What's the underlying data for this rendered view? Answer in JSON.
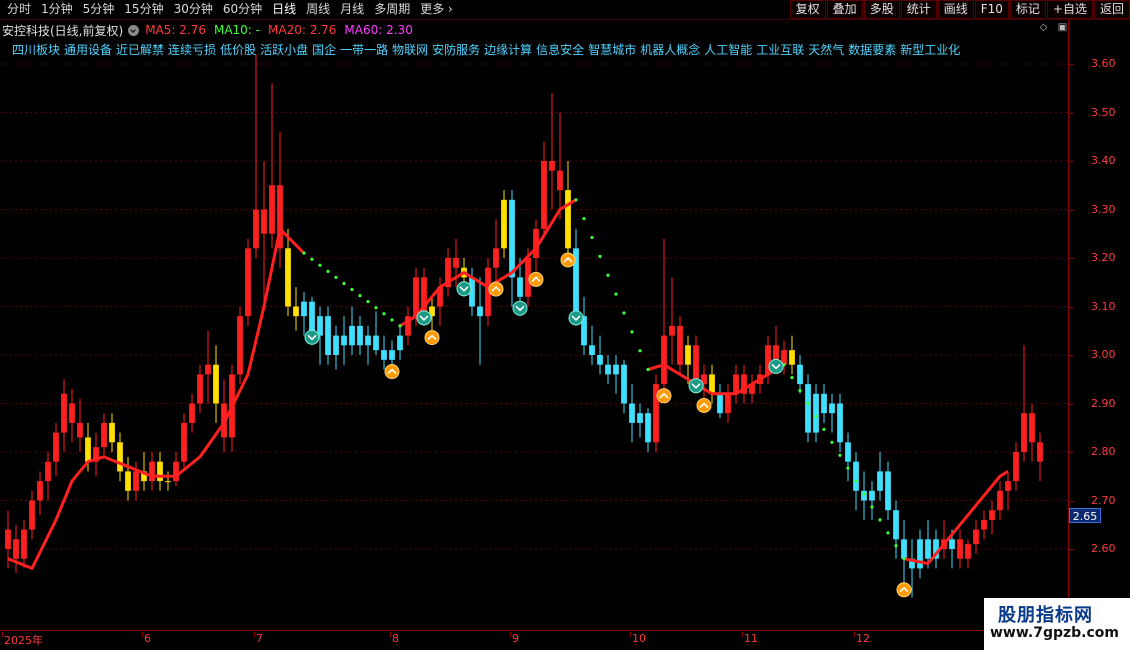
{
  "toolbar": {
    "periods": [
      "分时",
      "1分钟",
      "5分钟",
      "15分钟",
      "30分钟",
      "60分钟",
      "日线",
      "周线",
      "月线",
      "多周期",
      "更多"
    ],
    "active_period": "日线",
    "right_buttons": [
      "复权",
      "叠加",
      "多股",
      "统计",
      "画线",
      "F10",
      "标记",
      "+自选",
      "返回"
    ]
  },
  "title": {
    "stock": "安控科技(日线,前复权)",
    "ma": [
      {
        "label": "MA5: 2.76",
        "color": "#ff3b3b"
      },
      {
        "label": "MA10: -",
        "color": "#3bff3b"
      },
      {
        "label": "MA20: 2.76",
        "color": "#ff3b3b"
      },
      {
        "label": "MA60: 2.30",
        "color": "#ff3bff"
      }
    ]
  },
  "concepts": [
    "四川板块",
    "通用设备",
    "近已解禁",
    "连续亏损",
    "低价股",
    "活跃小盘",
    "国企",
    "一带一路",
    "物联网",
    "安防服务",
    "边缘计算",
    "信息安全",
    "智慧城市",
    "机器人概念",
    "人工智能",
    "工业互联",
    "天然气",
    "数据要素",
    "新型工业化"
  ],
  "price_axis": {
    "ticks": [
      "3.60",
      "3.50",
      "3.40",
      "3.30",
      "3.20",
      "3.10",
      "3.00",
      "2.90",
      "2.80",
      "2.70",
      "2.60"
    ],
    "current": "2.65"
  },
  "date_axis": {
    "ticks": [
      "2025年",
      "6",
      "7",
      "8",
      "9",
      "10",
      "11",
      "12"
    ]
  },
  "watermark": {
    "title": "股朋指标网",
    "url": "www.7gpzb.com"
  },
  "colors": {
    "up": "#ff2020",
    "down": "#3fe0ff",
    "signal_up": "#ffe000",
    "ma": "#ff2020",
    "dots": "#3bff3b",
    "grid": "#5a0000"
  },
  "chart_data": {
    "type": "candlestick",
    "y_range": [
      2.5,
      3.65
    ],
    "candles": [
      {
        "o": 2.6,
        "h": 2.68,
        "l": 2.56,
        "c": 2.64,
        "s": "up"
      },
      {
        "o": 2.62,
        "h": 2.65,
        "l": 2.55,
        "c": 2.58,
        "s": "up"
      },
      {
        "o": 2.58,
        "h": 2.66,
        "l": 2.56,
        "c": 2.64,
        "s": "up"
      },
      {
        "o": 2.64,
        "h": 2.72,
        "l": 2.62,
        "c": 2.7,
        "s": "up"
      },
      {
        "o": 2.7,
        "h": 2.76,
        "l": 2.67,
        "c": 2.74,
        "s": "up"
      },
      {
        "o": 2.74,
        "h": 2.8,
        "l": 2.7,
        "c": 2.78,
        "s": "up"
      },
      {
        "o": 2.78,
        "h": 2.86,
        "l": 2.75,
        "c": 2.84,
        "s": "up"
      },
      {
        "o": 2.84,
        "h": 2.95,
        "l": 2.8,
        "c": 2.92,
        "s": "up"
      },
      {
        "o": 2.9,
        "h": 2.93,
        "l": 2.82,
        "c": 2.86,
        "s": "up"
      },
      {
        "o": 2.86,
        "h": 2.91,
        "l": 2.8,
        "c": 2.83,
        "s": "up"
      },
      {
        "o": 2.83,
        "h": 2.86,
        "l": 2.76,
        "c": 2.78,
        "s": "y"
      },
      {
        "o": 2.78,
        "h": 2.84,
        "l": 2.75,
        "c": 2.81,
        "s": "up"
      },
      {
        "o": 2.81,
        "h": 2.88,
        "l": 2.79,
        "c": 2.86,
        "s": "up"
      },
      {
        "o": 2.86,
        "h": 2.88,
        "l": 2.8,
        "c": 2.82,
        "s": "y"
      },
      {
        "o": 2.82,
        "h": 2.84,
        "l": 2.74,
        "c": 2.76,
        "s": "y"
      },
      {
        "o": 2.76,
        "h": 2.79,
        "l": 2.7,
        "c": 2.72,
        "s": "y"
      },
      {
        "o": 2.72,
        "h": 2.78,
        "l": 2.7,
        "c": 2.76,
        "s": "up"
      },
      {
        "o": 2.76,
        "h": 2.8,
        "l": 2.72,
        "c": 2.74,
        "s": "y"
      },
      {
        "o": 2.74,
        "h": 2.8,
        "l": 2.72,
        "c": 2.78,
        "s": "up"
      },
      {
        "o": 2.78,
        "h": 2.8,
        "l": 2.72,
        "c": 2.74,
        "s": "y"
      },
      {
        "o": 2.74,
        "h": 2.76,
        "l": 2.72,
        "c": 2.74,
        "s": "y"
      },
      {
        "o": 2.74,
        "h": 2.8,
        "l": 2.73,
        "c": 2.78,
        "s": "up"
      },
      {
        "o": 2.78,
        "h": 2.88,
        "l": 2.76,
        "c": 2.86,
        "s": "up"
      },
      {
        "o": 2.86,
        "h": 2.92,
        "l": 2.84,
        "c": 2.9,
        "s": "up"
      },
      {
        "o": 2.9,
        "h": 2.98,
        "l": 2.88,
        "c": 2.96,
        "s": "up"
      },
      {
        "o": 2.96,
        "h": 3.05,
        "l": 2.9,
        "c": 2.98,
        "s": "up"
      },
      {
        "o": 2.98,
        "h": 3.02,
        "l": 2.86,
        "c": 2.9,
        "s": "y"
      },
      {
        "o": 2.9,
        "h": 2.95,
        "l": 2.8,
        "c": 2.83,
        "s": "up"
      },
      {
        "o": 2.83,
        "h": 2.98,
        "l": 2.8,
        "c": 2.96,
        "s": "up"
      },
      {
        "o": 2.96,
        "h": 3.1,
        "l": 2.94,
        "c": 3.08,
        "s": "up"
      },
      {
        "o": 3.08,
        "h": 3.24,
        "l": 3.06,
        "c": 3.22,
        "s": "up"
      },
      {
        "o": 3.22,
        "h": 3.62,
        "l": 3.2,
        "c": 3.3,
        "s": "up"
      },
      {
        "o": 3.3,
        "h": 3.4,
        "l": 3.1,
        "c": 3.25,
        "s": "up"
      },
      {
        "o": 3.25,
        "h": 3.56,
        "l": 3.22,
        "c": 3.35,
        "s": "up"
      },
      {
        "o": 3.35,
        "h": 3.46,
        "l": 3.18,
        "c": 3.22,
        "s": "up"
      },
      {
        "o": 3.22,
        "h": 3.26,
        "l": 3.08,
        "c": 3.1,
        "s": "y"
      },
      {
        "o": 3.1,
        "h": 3.14,
        "l": 3.05,
        "c": 3.08,
        "s": "y"
      },
      {
        "o": 3.08,
        "h": 3.13,
        "l": 3.04,
        "c": 3.11,
        "s": "dn"
      },
      {
        "o": 3.11,
        "h": 3.12,
        "l": 3.02,
        "c": 3.04,
        "s": "dn"
      },
      {
        "o": 3.04,
        "h": 3.1,
        "l": 2.98,
        "c": 3.08,
        "s": "dn"
      },
      {
        "o": 3.08,
        "h": 3.1,
        "l": 2.98,
        "c": 3.0,
        "s": "dn"
      },
      {
        "o": 3.0,
        "h": 3.06,
        "l": 2.97,
        "c": 3.04,
        "s": "dn"
      },
      {
        "o": 3.04,
        "h": 3.08,
        "l": 2.98,
        "c": 3.02,
        "s": "dn"
      },
      {
        "o": 3.02,
        "h": 3.1,
        "l": 3.0,
        "c": 3.06,
        "s": "dn"
      },
      {
        "o": 3.06,
        "h": 3.08,
        "l": 3.0,
        "c": 3.02,
        "s": "dn"
      },
      {
        "o": 3.02,
        "h": 3.06,
        "l": 2.98,
        "c": 3.04,
        "s": "dn"
      },
      {
        "o": 3.04,
        "h": 3.09,
        "l": 3.0,
        "c": 3.01,
        "s": "dn"
      },
      {
        "o": 3.01,
        "h": 3.04,
        "l": 2.97,
        "c": 2.99,
        "s": "dn"
      },
      {
        "o": 2.99,
        "h": 3.03,
        "l": 2.97,
        "c": 3.01,
        "s": "dn"
      },
      {
        "o": 3.01,
        "h": 3.06,
        "l": 2.99,
        "c": 3.04,
        "s": "dn"
      },
      {
        "o": 3.04,
        "h": 3.1,
        "l": 3.02,
        "c": 3.08,
        "s": "up"
      },
      {
        "o": 3.08,
        "h": 3.18,
        "l": 3.06,
        "c": 3.16,
        "s": "up"
      },
      {
        "o": 3.16,
        "h": 3.18,
        "l": 3.06,
        "c": 3.08,
        "s": "up"
      },
      {
        "o": 3.08,
        "h": 3.12,
        "l": 3.04,
        "c": 3.1,
        "s": "y"
      },
      {
        "o": 3.1,
        "h": 3.16,
        "l": 3.06,
        "c": 3.14,
        "s": "up"
      },
      {
        "o": 3.14,
        "h": 3.22,
        "l": 3.12,
        "c": 3.2,
        "s": "up"
      },
      {
        "o": 3.2,
        "h": 3.24,
        "l": 3.14,
        "c": 3.18,
        "s": "up"
      },
      {
        "o": 3.18,
        "h": 3.2,
        "l": 3.12,
        "c": 3.16,
        "s": "y"
      },
      {
        "o": 3.16,
        "h": 3.18,
        "l": 3.08,
        "c": 3.1,
        "s": "dn"
      },
      {
        "o": 3.1,
        "h": 3.16,
        "l": 2.98,
        "c": 3.08,
        "s": "dn"
      },
      {
        "o": 3.08,
        "h": 3.2,
        "l": 3.06,
        "c": 3.18,
        "s": "up"
      },
      {
        "o": 3.18,
        "h": 3.28,
        "l": 3.14,
        "c": 3.22,
        "s": "up"
      },
      {
        "o": 3.22,
        "h": 3.34,
        "l": 3.2,
        "c": 3.32,
        "s": "y"
      },
      {
        "o": 3.32,
        "h": 3.34,
        "l": 3.1,
        "c": 3.16,
        "s": "dn"
      },
      {
        "o": 3.16,
        "h": 3.2,
        "l": 3.08,
        "c": 3.12,
        "s": "dn"
      },
      {
        "o": 3.12,
        "h": 3.22,
        "l": 3.1,
        "c": 3.2,
        "s": "up"
      },
      {
        "o": 3.2,
        "h": 3.28,
        "l": 3.16,
        "c": 3.26,
        "s": "up"
      },
      {
        "o": 3.26,
        "h": 3.44,
        "l": 3.24,
        "c": 3.4,
        "s": "up"
      },
      {
        "o": 3.4,
        "h": 3.54,
        "l": 3.3,
        "c": 3.38,
        "s": "up"
      },
      {
        "o": 3.38,
        "h": 3.5,
        "l": 3.28,
        "c": 3.34,
        "s": "up"
      },
      {
        "o": 3.34,
        "h": 3.4,
        "l": 3.2,
        "c": 3.22,
        "s": "y"
      },
      {
        "o": 3.22,
        "h": 3.26,
        "l": 3.06,
        "c": 3.08,
        "s": "dn"
      },
      {
        "o": 3.08,
        "h": 3.12,
        "l": 3.0,
        "c": 3.02,
        "s": "dn"
      },
      {
        "o": 3.02,
        "h": 3.06,
        "l": 2.98,
        "c": 3.0,
        "s": "dn"
      },
      {
        "o": 3.0,
        "h": 3.04,
        "l": 2.96,
        "c": 2.98,
        "s": "dn"
      },
      {
        "o": 2.98,
        "h": 3.0,
        "l": 2.94,
        "c": 2.96,
        "s": "dn"
      },
      {
        "o": 2.96,
        "h": 3.0,
        "l": 2.92,
        "c": 2.98,
        "s": "dn"
      },
      {
        "o": 2.98,
        "h": 2.99,
        "l": 2.88,
        "c": 2.9,
        "s": "dn"
      },
      {
        "o": 2.9,
        "h": 2.94,
        "l": 2.82,
        "c": 2.86,
        "s": "dn"
      },
      {
        "o": 2.86,
        "h": 2.9,
        "l": 2.83,
        "c": 2.88,
        "s": "dn"
      },
      {
        "o": 2.88,
        "h": 2.89,
        "l": 2.8,
        "c": 2.82,
        "s": "dn"
      },
      {
        "o": 2.82,
        "h": 2.96,
        "l": 2.8,
        "c": 2.94,
        "s": "up"
      },
      {
        "o": 2.94,
        "h": 3.24,
        "l": 2.92,
        "c": 3.04,
        "s": "up"
      },
      {
        "o": 3.04,
        "h": 3.16,
        "l": 2.98,
        "c": 3.06,
        "s": "up"
      },
      {
        "o": 3.06,
        "h": 3.08,
        "l": 2.96,
        "c": 2.98,
        "s": "up"
      },
      {
        "o": 2.98,
        "h": 3.04,
        "l": 2.94,
        "c": 3.02,
        "s": "y"
      },
      {
        "o": 3.02,
        "h": 3.04,
        "l": 2.92,
        "c": 2.94,
        "s": "up"
      },
      {
        "o": 2.94,
        "h": 2.98,
        "l": 2.9,
        "c": 2.96,
        "s": "up"
      },
      {
        "o": 2.96,
        "h": 2.98,
        "l": 2.9,
        "c": 2.92,
        "s": "y"
      },
      {
        "o": 2.92,
        "h": 2.94,
        "l": 2.87,
        "c": 2.88,
        "s": "dn"
      },
      {
        "o": 2.88,
        "h": 2.94,
        "l": 2.86,
        "c": 2.92,
        "s": "up"
      },
      {
        "o": 2.92,
        "h": 2.98,
        "l": 2.9,
        "c": 2.96,
        "s": "up"
      },
      {
        "o": 2.96,
        "h": 2.98,
        "l": 2.9,
        "c": 2.92,
        "s": "up"
      },
      {
        "o": 2.92,
        "h": 2.96,
        "l": 2.9,
        "c": 2.94,
        "s": "up"
      },
      {
        "o": 2.94,
        "h": 2.98,
        "l": 2.92,
        "c": 2.96,
        "s": "up"
      },
      {
        "o": 2.96,
        "h": 3.04,
        "l": 2.94,
        "c": 3.02,
        "s": "up"
      },
      {
        "o": 3.02,
        "h": 3.06,
        "l": 2.96,
        "c": 2.98,
        "s": "up"
      },
      {
        "o": 2.98,
        "h": 3.03,
        "l": 2.96,
        "c": 3.01,
        "s": "up"
      },
      {
        "o": 3.01,
        "h": 3.04,
        "l": 2.96,
        "c": 2.98,
        "s": "y"
      },
      {
        "o": 2.98,
        "h": 3.0,
        "l": 2.92,
        "c": 2.94,
        "s": "dn"
      },
      {
        "o": 2.94,
        "h": 2.96,
        "l": 2.82,
        "c": 2.84,
        "s": "dn"
      },
      {
        "o": 2.84,
        "h": 2.94,
        "l": 2.82,
        "c": 2.92,
        "s": "dn"
      },
      {
        "o": 2.92,
        "h": 2.94,
        "l": 2.86,
        "c": 2.88,
        "s": "dn"
      },
      {
        "o": 2.88,
        "h": 2.92,
        "l": 2.84,
        "c": 2.9,
        "s": "dn"
      },
      {
        "o": 2.9,
        "h": 2.92,
        "l": 2.8,
        "c": 2.82,
        "s": "dn"
      },
      {
        "o": 2.82,
        "h": 2.84,
        "l": 2.74,
        "c": 2.78,
        "s": "dn"
      },
      {
        "o": 2.78,
        "h": 2.8,
        "l": 2.68,
        "c": 2.72,
        "s": "dn"
      },
      {
        "o": 2.72,
        "h": 2.76,
        "l": 2.66,
        "c": 2.7,
        "s": "dn"
      },
      {
        "o": 2.7,
        "h": 2.74,
        "l": 2.66,
        "c": 2.72,
        "s": "dn"
      },
      {
        "o": 2.72,
        "h": 2.8,
        "l": 2.7,
        "c": 2.76,
        "s": "dn"
      },
      {
        "o": 2.76,
        "h": 2.78,
        "l": 2.66,
        "c": 2.68,
        "s": "dn"
      },
      {
        "o": 2.68,
        "h": 2.7,
        "l": 2.58,
        "c": 2.62,
        "s": "dn"
      },
      {
        "o": 2.62,
        "h": 2.66,
        "l": 2.52,
        "c": 2.58,
        "s": "dn"
      },
      {
        "o": 2.58,
        "h": 2.62,
        "l": 2.5,
        "c": 2.56,
        "s": "dn"
      },
      {
        "o": 2.56,
        "h": 2.64,
        "l": 2.54,
        "c": 2.62,
        "s": "dn"
      },
      {
        "o": 2.62,
        "h": 2.66,
        "l": 2.56,
        "c": 2.58,
        "s": "dn"
      },
      {
        "o": 2.58,
        "h": 2.64,
        "l": 2.56,
        "c": 2.62,
        "s": "dn"
      },
      {
        "o": 2.62,
        "h": 2.66,
        "l": 2.58,
        "c": 2.6,
        "s": "up"
      },
      {
        "o": 2.6,
        "h": 2.64,
        "l": 2.56,
        "c": 2.62,
        "s": "dn"
      },
      {
        "o": 2.62,
        "h": 2.64,
        "l": 2.56,
        "c": 2.58,
        "s": "up"
      },
      {
        "o": 2.58,
        "h": 2.62,
        "l": 2.56,
        "c": 2.61,
        "s": "up"
      },
      {
        "o": 2.61,
        "h": 2.66,
        "l": 2.59,
        "c": 2.64,
        "s": "up"
      },
      {
        "o": 2.64,
        "h": 2.68,
        "l": 2.62,
        "c": 2.66,
        "s": "up"
      },
      {
        "o": 2.66,
        "h": 2.7,
        "l": 2.63,
        "c": 2.68,
        "s": "up"
      },
      {
        "o": 2.68,
        "h": 2.74,
        "l": 2.66,
        "c": 2.72,
        "s": "up"
      },
      {
        "o": 2.72,
        "h": 2.76,
        "l": 2.68,
        "c": 2.74,
        "s": "up"
      },
      {
        "o": 2.74,
        "h": 2.82,
        "l": 2.72,
        "c": 2.8,
        "s": "up"
      },
      {
        "o": 2.8,
        "h": 3.02,
        "l": 2.78,
        "c": 2.88,
        "s": "up"
      },
      {
        "o": 2.88,
        "h": 2.9,
        "l": 2.78,
        "c": 2.82,
        "s": "up"
      },
      {
        "o": 2.82,
        "h": 2.84,
        "l": 2.74,
        "c": 2.78,
        "s": "up"
      }
    ],
    "ma_segments": [
      [
        [
          0,
          2.58
        ],
        [
          3,
          2.56
        ],
        [
          6,
          2.66
        ],
        [
          8,
          2.74
        ],
        [
          10,
          2.78
        ],
        [
          12,
          2.79
        ],
        [
          15,
          2.77
        ],
        [
          18,
          2.75
        ],
        [
          21,
          2.75
        ],
        [
          24,
          2.79
        ],
        [
          27,
          2.86
        ],
        [
          30,
          2.96
        ],
        [
          32,
          3.1
        ],
        [
          34,
          3.26
        ],
        [
          37,
          3.21
        ]
      ],
      [
        [
          49,
          3.06
        ],
        [
          51,
          3.08
        ],
        [
          54,
          3.14
        ],
        [
          57,
          3.17
        ],
        [
          60,
          3.14
        ],
        [
          63,
          3.17
        ],
        [
          66,
          3.22
        ],
        [
          69,
          3.3
        ],
        [
          71,
          3.32
        ]
      ],
      [
        [
          80,
          2.97
        ],
        [
          82,
          2.98
        ],
        [
          85,
          2.95
        ],
        [
          88,
          2.92
        ],
        [
          91,
          2.92
        ],
        [
          94,
          2.95
        ],
        [
          97,
          2.98
        ]
      ],
      [
        [
          112,
          2.58
        ],
        [
          115,
          2.57
        ],
        [
          118,
          2.63
        ],
        [
          121,
          2.69
        ],
        [
          124,
          2.75
        ],
        [
          125,
          2.76
        ]
      ]
    ],
    "dot_segments": [
      [
        37,
        49
      ],
      [
        71,
        80
      ],
      [
        97,
        112
      ]
    ],
    "buy_signals": [
      48,
      53,
      61,
      66,
      70,
      82,
      87,
      112
    ],
    "sell_signals": [
      38,
      52,
      57,
      64,
      71,
      86,
      96
    ]
  }
}
